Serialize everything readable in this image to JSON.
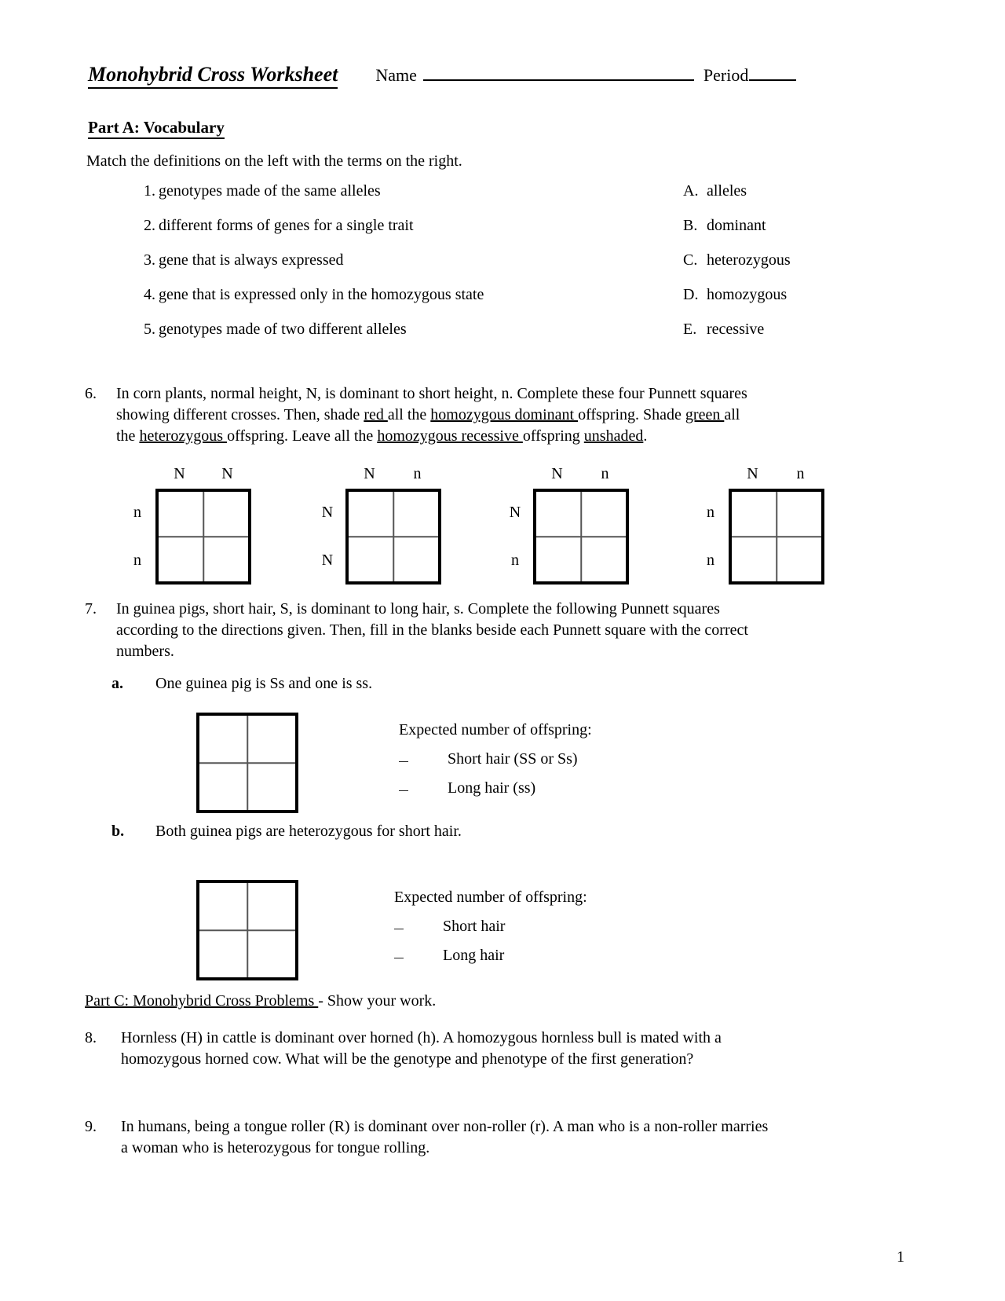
{
  "header": {
    "title": "Monohybrid Cross Worksheet",
    "name_label": "Name",
    "period_label": "Period"
  },
  "part_a": {
    "heading": "Part A:  Vocabulary",
    "instruction": "Match the definitions on the left with the terms on the right.",
    "definitions": [
      {
        "num": "1.",
        "text": "genotypes made of the same alleles"
      },
      {
        "num": "2.",
        "text": "different forms of genes for a single trait"
      },
      {
        "num": "3.",
        "text": "gene that is always expressed"
      },
      {
        "num": "4.",
        "text": "gene that is expressed only in the homozygous state"
      },
      {
        "num": "5.",
        "text": "genotypes made of two different alleles"
      }
    ],
    "terms": [
      {
        "letter": "A.",
        "text": "alleles"
      },
      {
        "letter": "B.",
        "text": "dominant"
      },
      {
        "letter": "C.",
        "text": "heterozygous"
      },
      {
        "letter": "D.",
        "text": "homozygous"
      },
      {
        "letter": "E.",
        "text": "recessive"
      }
    ]
  },
  "question6": {
    "num": "6.",
    "line1": "In corn plants, normal height, N, is dominant to short height, n.  Complete these four Punnett  squares",
    "line2_a": "showing different crosses.  Then, shade ",
    "line2_u1": "red ",
    "line2_b": "all the ",
    "line2_u2": "homozygous dominant ",
    "line2_c": "offspring.  Shade ",
    "line2_u3": "green ",
    "line2_d": "all",
    "line3_a": "the ",
    "line3_u1": "heterozygous ",
    "line3_b": "offspring.  Leave all the ",
    "line3_u2": "homozygous recessive ",
    "line3_c": "offspring  ",
    "line3_u3": "unshaded",
    "line3_d": ".",
    "squares": [
      {
        "cols": [
          "N",
          "N"
        ],
        "rows": [
          "n",
          "n"
        ]
      },
      {
        "cols": [
          "N",
          "n"
        ],
        "rows": [
          "N",
          "N"
        ]
      },
      {
        "cols": [
          "N",
          "n"
        ],
        "rows": [
          "N",
          "n"
        ]
      },
      {
        "cols": [
          "N",
          "n"
        ],
        "rows": [
          "n",
          "n"
        ]
      }
    ]
  },
  "question7": {
    "num": "7.",
    "line1": "In guinea pigs, short hair, S, is dominant to long hair, s.  Complete the following Punnett squares",
    "line2": "according to the directions given.  Then, fill in the blanks beside each Punnett square with the  correct",
    "line3": "numbers.",
    "part_a": {
      "letter": "a.",
      "text": "One guinea pig is Ss  and one is ss.",
      "expected_title": "Expected number of offspring:",
      "expected_lines": [
        "Short hair   (SS or Ss)",
        "Long hair  (ss)"
      ]
    },
    "part_b": {
      "letter": "b.",
      "text": "Both guinea pigs are heterozygous  for short hair.",
      "expected_title": "Expected number of offspring:",
      "expected_lines": [
        "Short hair",
        "Long hair"
      ]
    }
  },
  "part_c": {
    "heading_underlined": "Part C:  Monohybrid Cross Problems ",
    "heading_rest": "-  Show your work."
  },
  "question8": {
    "num": "8.",
    "line1": "Hornless (H) in cattle is dominant over horned (h).  A homozygous hornless bull is mated with  a",
    "line2": "homozygous horned cow.  What will be the genotype and phenotype of the first generation?"
  },
  "question9": {
    "num": "9.",
    "line1": "In humans, being a tongue roller (R) is dominant over non-roller (r).  A man who is a non-roller  marries",
    "line2": "a woman who is heterozygous for tongue rolling."
  },
  "footer": {
    "page_number": "1"
  }
}
